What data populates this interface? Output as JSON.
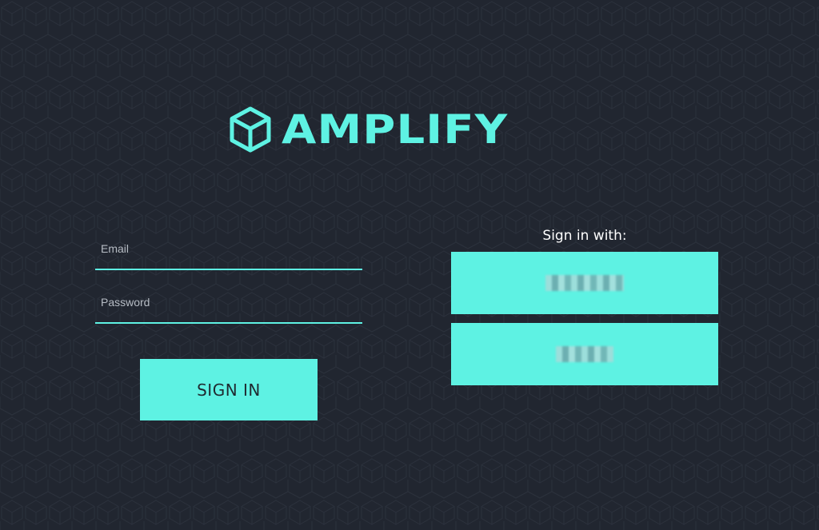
{
  "brand": {
    "name": "AMPLIFY",
    "logo_icon": "cube-icon",
    "accent_color": "#5ef2e3",
    "background_color": "#212630"
  },
  "login_form": {
    "email": {
      "placeholder": "Email",
      "value": ""
    },
    "password": {
      "placeholder": "Password",
      "value": ""
    },
    "submit_label": "SIGN IN"
  },
  "social_login": {
    "heading": "Sign in with:",
    "providers": [
      {
        "label": "",
        "redacted": true
      },
      {
        "label": "",
        "redacted": true
      }
    ]
  }
}
